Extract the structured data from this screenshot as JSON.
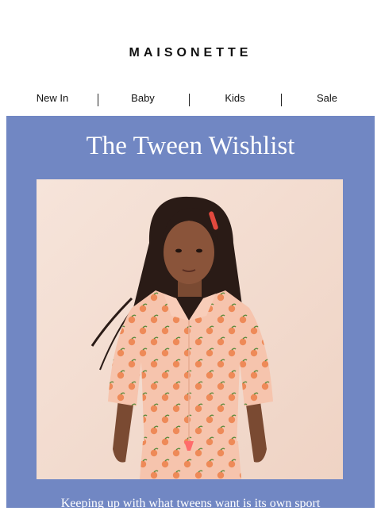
{
  "brand": {
    "logo_text": "MAISONETTE"
  },
  "nav": {
    "items": [
      {
        "label": "New In"
      },
      {
        "label": "Baby"
      },
      {
        "label": "Kids"
      },
      {
        "label": "Sale"
      }
    ]
  },
  "hero": {
    "title": "The Tween Wishlist",
    "blurb": "Keeping up with what tweens want is its own sport",
    "background_color": "#7187c3"
  }
}
